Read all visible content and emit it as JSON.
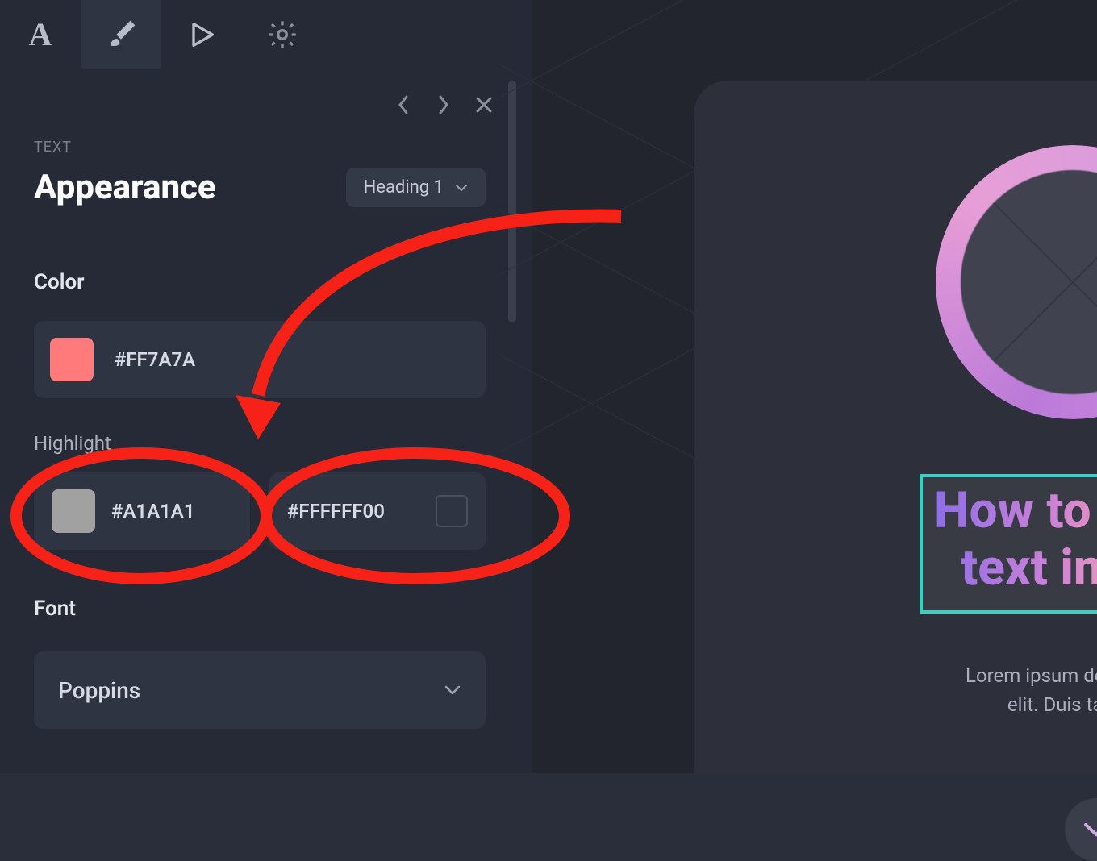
{
  "toolbar": {
    "tabs": [
      {
        "name": "text-tool",
        "active": false
      },
      {
        "name": "brush-tool",
        "active": true
      },
      {
        "name": "play-tool",
        "active": false
      },
      {
        "name": "settings-tool",
        "active": false
      }
    ]
  },
  "panel": {
    "section_label": "TEXT",
    "title": "Appearance",
    "style_dropdown": "Heading 1",
    "color": {
      "label": "Color",
      "hex": "#FF7A7A",
      "swatch": "#ff7a7a"
    },
    "highlight": {
      "label": "Highlight",
      "start_hex": "#A1A1A1",
      "start_swatch": "#a1a1a1",
      "end_hex": "#FFFFFF00"
    },
    "font": {
      "label": "Font",
      "value": "Poppins"
    }
  },
  "canvas": {
    "title_line1": "How to hig",
    "title_line2": "text in C",
    "lorem_line1": "Lorem ipsum dolor sit amet co",
    "lorem_line2": "elit. Duis taciti ad lito"
  },
  "colors": {
    "highlight_border": "#3dd0c2",
    "ring_gradient_a": "#bb7ad9",
    "ring_gradient_b": "#e79ed6",
    "annotation_red": "#f62217"
  }
}
